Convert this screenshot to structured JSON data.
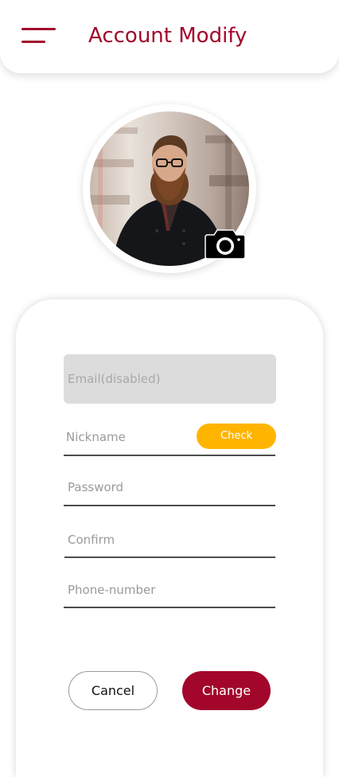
{
  "header": {
    "title": "Account Modify",
    "menu_icon": "hamburger-menu-icon"
  },
  "profile": {
    "avatar": "profile-photo",
    "camera_icon": "camera-icon"
  },
  "form": {
    "email_placeholder": "Email(disabled)",
    "nickname_placeholder": "Nickname",
    "check_label": "Check",
    "password_placeholder": "Password",
    "confirm_placeholder": "Confirm",
    "phone_placeholder": "Phone-number"
  },
  "actions": {
    "cancel_label": "Cancel",
    "change_label": "Change"
  },
  "colors": {
    "brand": "#a2072b",
    "check_button": "#ffb400",
    "disabled_field": "#dcdcdc",
    "placeholder_text": "#9a9a9a"
  }
}
